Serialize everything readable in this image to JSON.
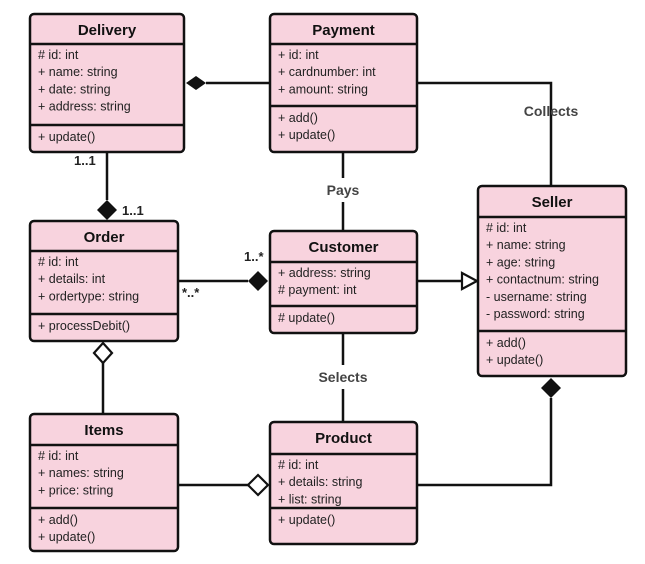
{
  "classes": [
    {
      "name": "Delivery",
      "attributes": [
        "# id: int",
        "+ name: string",
        "+ date: string",
        "+ address: string"
      ],
      "methods": [
        "+ update()"
      ]
    },
    {
      "name": "Payment",
      "attributes": [
        "+ id: int",
        "+ cardnumber: int",
        "+ amount: string"
      ],
      "methods": [
        "+ add()",
        "+ update()"
      ]
    },
    {
      "name": "Order",
      "attributes": [
        "# id: int",
        "+ details: int",
        "+ ordertype: string"
      ],
      "methods": [
        "+ processDebit()"
      ]
    },
    {
      "name": "Customer",
      "attributes": [
        "+ address: string",
        "# payment: int"
      ],
      "methods": [
        "# update()"
      ]
    },
    {
      "name": "Seller",
      "attributes": [
        "# id: int",
        "+ name: string",
        "+ age: string",
        "+ contactnum: string",
        "- username: string",
        "- password: string"
      ],
      "methods": [
        "+ add()",
        "+ update()"
      ]
    },
    {
      "name": "Items",
      "attributes": [
        "# id: int",
        "+ names: string",
        "+ price: string"
      ],
      "methods": [
        "+ add()",
        "+ update()"
      ]
    },
    {
      "name": "Product",
      "attributes": [
        "# id: int",
        "+ details: string",
        "+ list: string"
      ],
      "methods": [
        "+ update()"
      ]
    }
  ],
  "relationships": [
    {
      "from": "Delivery",
      "to": "Payment",
      "type": "composition"
    },
    {
      "from": "Payment",
      "to": "Seller",
      "type": "association",
      "label": "Collects"
    },
    {
      "from": "Delivery",
      "to": "Order",
      "type": "composition",
      "multiplicity_from": "1..1",
      "multiplicity_to": "1..1"
    },
    {
      "from": "Payment",
      "to": "Customer",
      "type": "association",
      "label": "Pays"
    },
    {
      "from": "Order",
      "to": "Customer",
      "type": "composition",
      "multiplicity_from": "*..*",
      "multiplicity_to": "1..*"
    },
    {
      "from": "Customer",
      "to": "Seller",
      "type": "generalization"
    },
    {
      "from": "Customer",
      "to": "Product",
      "type": "association",
      "label": "Selects"
    },
    {
      "from": "Items",
      "to": "Order",
      "type": "aggregation"
    },
    {
      "from": "Items",
      "to": "Product",
      "type": "aggregation"
    },
    {
      "from": "Product",
      "to": "Seller",
      "type": "composition"
    }
  ],
  "colors": {
    "class_fill": "#f8d3de",
    "stroke": "#111111"
  }
}
